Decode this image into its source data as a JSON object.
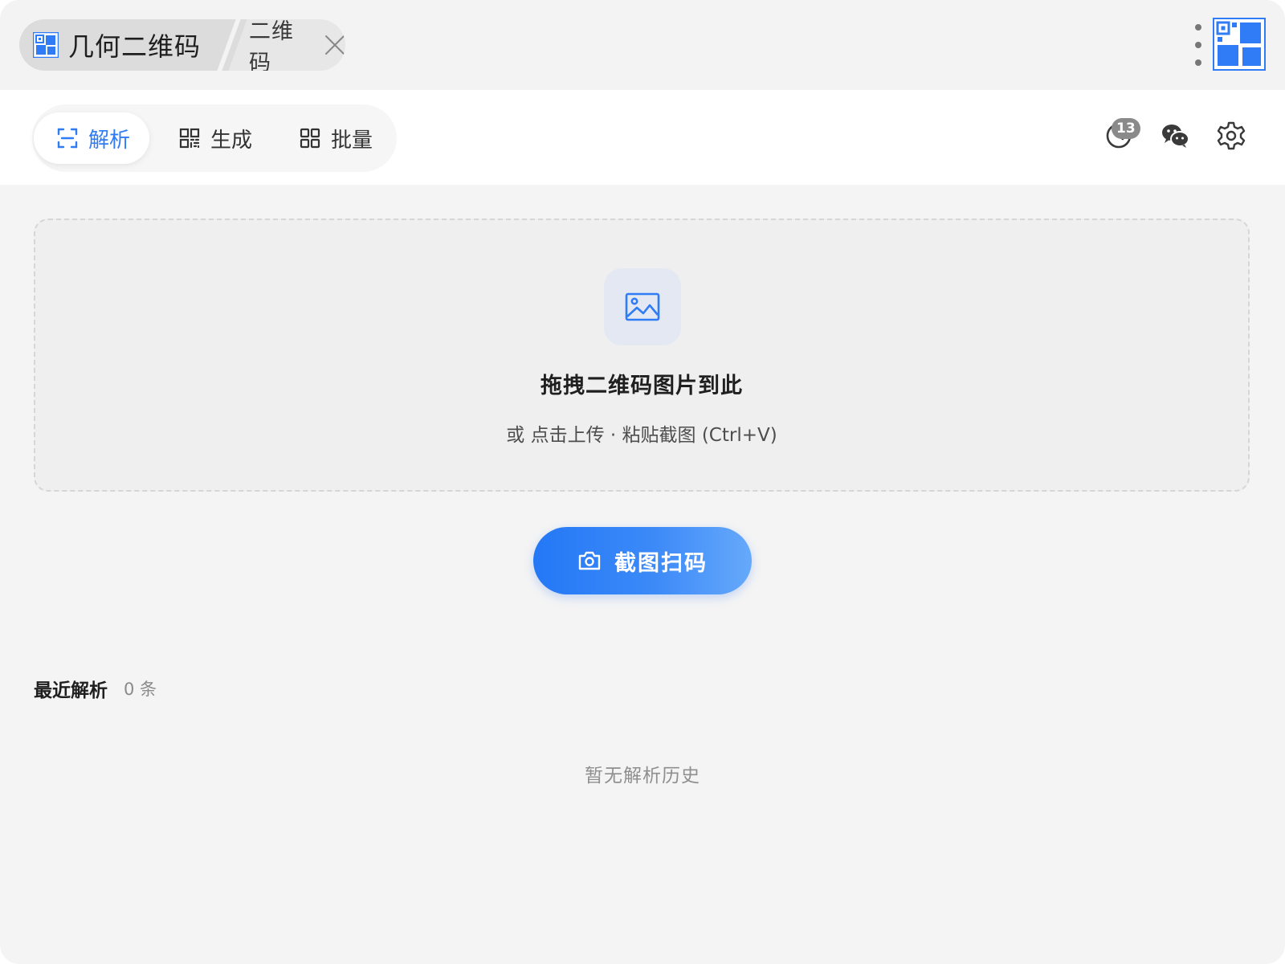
{
  "titlebar": {
    "app_title": "几何二维码",
    "doc_tab_label": "二维码",
    "icons": [
      "app-logo-icon",
      "close-icon",
      "more-vertical-icon",
      "brand-logo-icon"
    ]
  },
  "toolbar": {
    "tabs": [
      {
        "label": "解析",
        "icon": "scan-frame-icon",
        "active": true
      },
      {
        "label": "生成",
        "icon": "qr-code-icon",
        "active": false
      },
      {
        "label": "批量",
        "icon": "grid-icon",
        "active": false
      }
    ],
    "history_badge": "13",
    "icons": [
      "history-icon",
      "wechat-icon",
      "gear-icon"
    ]
  },
  "dropzone": {
    "icon": "image-icon",
    "title": "拖拽二维码图片到此",
    "subtitle": "或 点击上传 · 粘贴截图 (Ctrl+V)"
  },
  "capture_button": {
    "icon": "camera-icon",
    "label": "截图扫码"
  },
  "recent": {
    "title": "最近解析",
    "count": "0 条",
    "empty_text": "暂无解析历史"
  },
  "colors": {
    "accent": "#2f7cf6",
    "button_gradient_start": "#2478f6",
    "button_gradient_end": "#66a9fb",
    "window_bg": "#f4f4f4",
    "badge_bg": "#8a8a8a"
  }
}
